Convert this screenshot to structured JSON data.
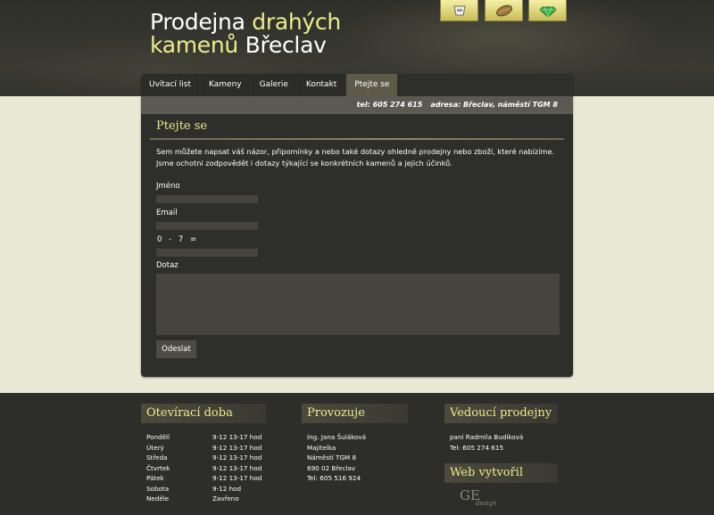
{
  "header": {
    "title_line1_plain": "Prodejna ",
    "title_line1_accent": "drahých",
    "title_line2_accent": "kamenů",
    "title_line2_plain": " Břeclav"
  },
  "top_icons": [
    "cup-icon",
    "stone-icon",
    "gem-icon"
  ],
  "nav": {
    "items": [
      {
        "label": "Uvítací list",
        "active": false
      },
      {
        "label": "Kameny",
        "active": false
      },
      {
        "label": "Galerie",
        "active": false
      },
      {
        "label": "Kontakt",
        "active": false
      },
      {
        "label": "Ptejte se",
        "active": true
      }
    ]
  },
  "info_bar": {
    "phone": "tel: 605 274 615",
    "address": "adresa: Břeclav, náměstí TGM 8"
  },
  "content": {
    "title": "Ptejte se",
    "intro": "Sem můžete napsat váš názor, připomínky a nebo také dotazy ohledně prodejny nebo zboží, které nabízíme. Jsme ochotni zodpovědět i dotazy týkající se konkrétních kamenů a jejich účinků.",
    "form": {
      "name_label": "Jméno",
      "name_value": "",
      "email_label": "Email",
      "email_value": "",
      "captcha_text": "0 - 7 =",
      "captcha_value": "",
      "question_label": "Dotaz",
      "question_value": "",
      "submit_label": "Odeslat"
    }
  },
  "footer": {
    "hours": {
      "title": "Otevírací doba",
      "rows": [
        {
          "day": "Pondělí",
          "time": "9-12  13-17 hod"
        },
        {
          "day": "Úterý",
          "time": "9-12  13-17 hod"
        },
        {
          "day": "Středa",
          "time": "9-12  13-17 hod"
        },
        {
          "day": "Čtvrtek",
          "time": "9-12  13-17 hod"
        },
        {
          "day": "Pátek",
          "time": "9-12  13-17 hod"
        },
        {
          "day": "Sobota",
          "time": "9-12 hod"
        },
        {
          "day": "Neděle",
          "time": "Zavřeno"
        }
      ]
    },
    "operator": {
      "title": "Provozuje",
      "lines": [
        "Ing. Jana Šuláková",
        "Majitelka",
        "Náměstí TGM 8",
        "690 02 Břeclav",
        "Tel: 605 516 924"
      ]
    },
    "manager": {
      "title": "Vedoucí prodejny",
      "lines": [
        "paní Radmila Budíková",
        "Tel: 605 274 615"
      ]
    },
    "creator": {
      "title": "Web vytvořil",
      "logo_main": "GE",
      "logo_script": "design"
    }
  },
  "colors": {
    "accent_yellow": "#ecec8d",
    "panel_dark": "#2e2e2a",
    "page_light": "#e9e9d6",
    "active_tab": "#5d5a4a"
  }
}
